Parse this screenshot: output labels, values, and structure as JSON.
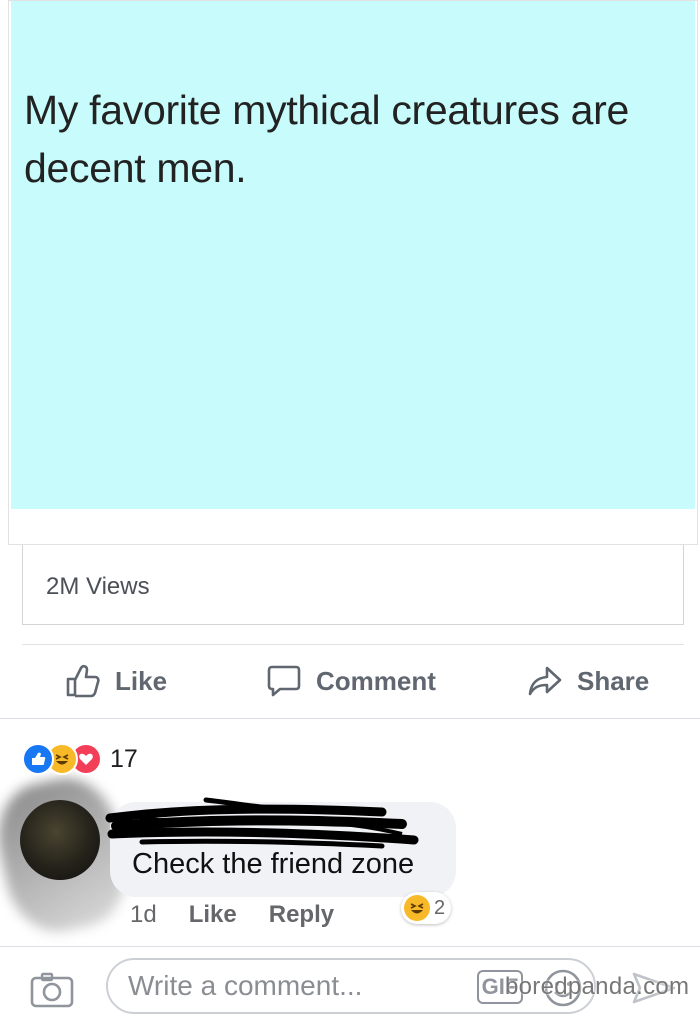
{
  "post": {
    "text": "My favorite mythical creatures are decent men.",
    "image_bg": "#c8fbfb",
    "views": "2M Views"
  },
  "actions": {
    "like_label": "Like",
    "comment_label": "Comment",
    "share_label": "Share"
  },
  "reactions": {
    "types": [
      "like-icon",
      "haha-icon",
      "love-icon"
    ],
    "count": "17"
  },
  "comment": {
    "text": "Check the friend zone",
    "time": "1d",
    "like_label": "Like",
    "reply_label": "Reply",
    "reaction_count": "2"
  },
  "composer": {
    "placeholder": "Write a comment...",
    "gif_label": "GIF"
  },
  "watermark": "boredpanda.com",
  "colors": {
    "like_blue": "#1877f2",
    "haha_yellow": "#f7b928",
    "love_red": "#f33e58",
    "action_gray": "#606770"
  }
}
